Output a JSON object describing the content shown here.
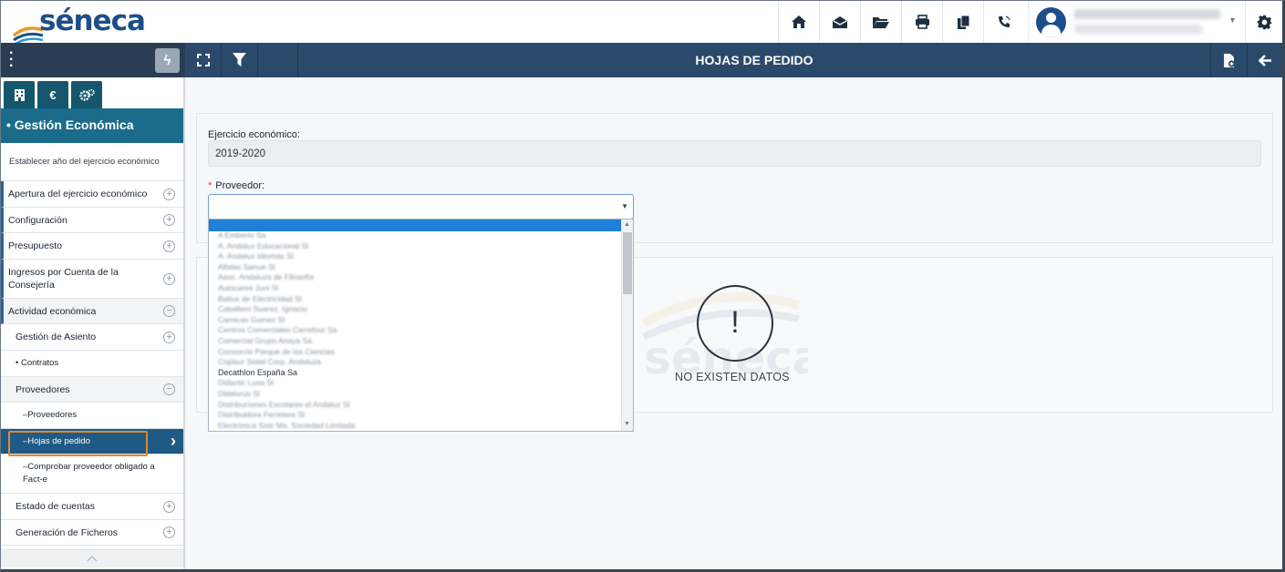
{
  "header": {
    "logo_text": "séneca",
    "icons": [
      "home-icon",
      "mail-icon",
      "folder-icon",
      "print-icon",
      "copy-icon",
      "phone-icon"
    ],
    "settings_icon": "gear-icon"
  },
  "navbar": {
    "title": "HOJAS DE PEDIDO",
    "left_icons": [
      "expand-icon",
      "filter-icon"
    ],
    "right_icons": [
      "new-document-icon",
      "back-arrow-icon"
    ]
  },
  "sidebar": {
    "section_title": "• Gestión Económica",
    "tabs": [
      "building-icon",
      "euro-icon",
      "cogs-icon"
    ],
    "items": [
      {
        "label": "Establecer año del ejercicio económico",
        "toggle": ""
      },
      {
        "label": "Apertura del ejercicio económico",
        "toggle": "+"
      },
      {
        "label": "Configuración",
        "toggle": "+"
      },
      {
        "label": "Presupuesto",
        "toggle": "+"
      },
      {
        "label": "Ingresos por Cuenta de la Consejería",
        "toggle": "+"
      },
      {
        "label": "Actividad económica",
        "toggle": "−"
      },
      {
        "label": "Gestión de Asiento",
        "toggle": "+"
      },
      {
        "label": "• Contratos",
        "toggle": ""
      },
      {
        "label": "Proveedores",
        "toggle": "−"
      },
      {
        "label": "–Proveedores",
        "toggle": ""
      },
      {
        "label": "–Hojas de pedido",
        "toggle": "›"
      },
      {
        "label": "–Comprobar proveedor obligado a Fact-e",
        "toggle": ""
      },
      {
        "label": "Estado de cuentas",
        "toggle": "+"
      },
      {
        "label": "Generación de Ficheros",
        "toggle": "+"
      }
    ]
  },
  "form": {
    "ejercicio_label": "Ejercicio económico:",
    "ejercicio_value": "2019-2020",
    "proveedor_label": "Proveedor:",
    "required_mark": "*",
    "proveedor_value": ""
  },
  "dropdown": {
    "items": [
      "A Emberto Sa",
      "A. Andalux Educacional Sl",
      "A. Andalux Idiomas Sl",
      "Alfalas Sanue Sl",
      "Asoc. Andaluza de Filosofía",
      "Autocares Juni Sl",
      "Batiux de Electricidad Sl",
      "Caballero Suarez, Ignacio",
      "Carnicas Gomez Sl",
      "Centros Comerciales Carrefour Sa",
      "Comercial Grupo Anaya Sa",
      "Consorcio Parque de las Ciencias",
      "Copisur Sistel Corp. Andaluza",
      "Decathlon España Sa",
      "Didactic Lusa Sl",
      "Didalurus Sl",
      "Distribuciones Escolares el Andaluz Sl",
      "Distribuidora Ferretera Sl",
      "Electrónica Sistr Ma. Sociedad Limitada"
    ],
    "visible_item": "Decathlon España Sa"
  },
  "empty_state": {
    "icon": "!",
    "message": "NO EXISTEN DATOS"
  }
}
